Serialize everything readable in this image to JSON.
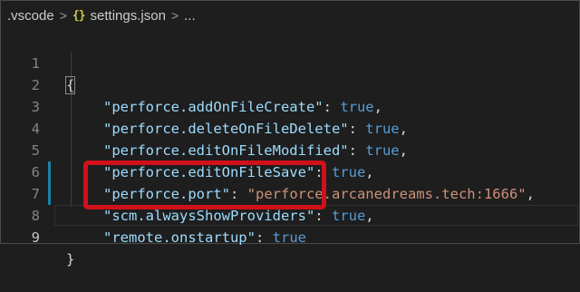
{
  "breadcrumb": {
    "folder": ".vscode",
    "separator": ">",
    "file_icon": "{}",
    "file": "settings.json",
    "separator2": ">",
    "trail": "..."
  },
  "editor": {
    "lines": [
      {
        "num": "1",
        "brace": "{"
      },
      {
        "num": "2",
        "key": "\"perforce.addOnFileCreate\"",
        "sep": ": ",
        "value": "true",
        "end": ","
      },
      {
        "num": "3",
        "key": "\"perforce.deleteOnFileDelete\"",
        "sep": ": ",
        "value": "true",
        "end": ","
      },
      {
        "num": "4",
        "key": "\"perforce.editOnFileModified\"",
        "sep": ": ",
        "value": "true",
        "end": ","
      },
      {
        "num": "5",
        "key": "\"perforce.editOnFileSave\"",
        "sep": ": ",
        "value": "true",
        "end": ","
      },
      {
        "num": "6",
        "key": "\"perforce.port\"",
        "sep": ": ",
        "value": "\"perforce.arcanedreams.tech:1666\"",
        "end": ","
      },
      {
        "num": "7",
        "key": "\"scm.alwaysShowProviders\"",
        "sep": ": ",
        "value": "true",
        "end": ","
      },
      {
        "num": "8",
        "key": "\"remote.onstartup\"",
        "sep": ": ",
        "value": "true"
      },
      {
        "num": "9",
        "brace": "}"
      }
    ]
  },
  "colors": {
    "background": "#1e1e1e",
    "key": "#9cdcfe",
    "string": "#ce9178",
    "keyword": "#569cd6",
    "annotation_box": "#d0101a",
    "modified_gutter": "#1b81a8"
  }
}
